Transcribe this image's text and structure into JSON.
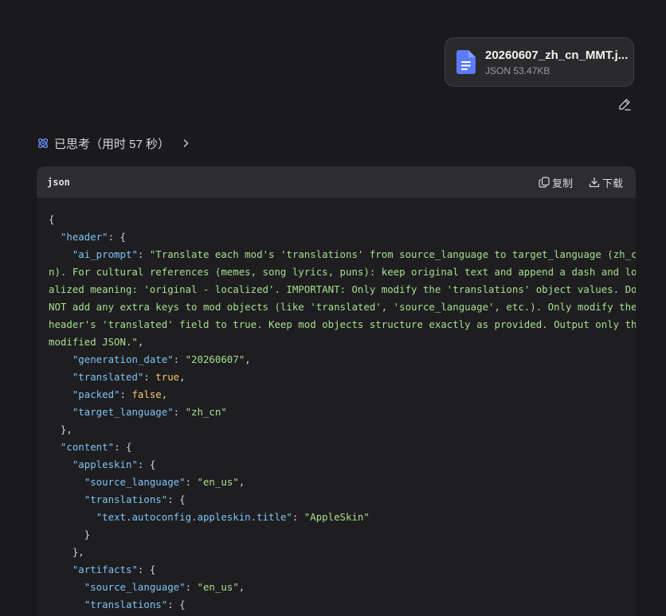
{
  "attachment": {
    "file_name": "20260607_zh_cn_MMT.j...",
    "file_info": "JSON 53.47KB",
    "icon": "document-icon",
    "icon_color": "#5b7cf6"
  },
  "thinking": {
    "label": "已思考（用时 57 秒）",
    "icon": "atom-icon",
    "icon_color": "#6c8cff"
  },
  "code_block": {
    "language": "json",
    "copy_label": "复制",
    "download_label": "下载",
    "lines": [
      [
        {
          "t": "p",
          "v": "{"
        }
      ],
      [
        {
          "t": "p",
          "v": "  "
        },
        {
          "t": "k",
          "v": "\"header\""
        },
        {
          "t": "p",
          "v": ": {"
        }
      ],
      [
        {
          "t": "p",
          "v": "    "
        },
        {
          "t": "k",
          "v": "\"ai_prompt\""
        },
        {
          "t": "p",
          "v": ": "
        },
        {
          "t": "s",
          "v": "\"Translate each mod's 'translations' from source_language to target_language (zh_c"
        }
      ],
      [
        {
          "t": "s",
          "v": "n). For cultural references (memes, song lyrics, puns): keep original text and append a dash and loc"
        }
      ],
      [
        {
          "t": "s",
          "v": "alized meaning: 'original - localized'. IMPORTANT: Only modify the 'translations' object values. Do"
        }
      ],
      [
        {
          "t": "s",
          "v": "NOT add any extra keys to mod objects (like 'translated', 'source_language', etc.). Only modify the"
        }
      ],
      [
        {
          "t": "s",
          "v": "header's 'translated' field to true. Keep mod objects structure exactly as provided. Output only the"
        }
      ],
      [
        {
          "t": "s",
          "v": "modified JSON.\""
        },
        {
          "t": "p",
          "v": ","
        }
      ],
      [
        {
          "t": "p",
          "v": "    "
        },
        {
          "t": "k",
          "v": "\"generation_date\""
        },
        {
          "t": "p",
          "v": ": "
        },
        {
          "t": "s",
          "v": "\"20260607\""
        },
        {
          "t": "p",
          "v": ","
        }
      ],
      [
        {
          "t": "p",
          "v": "    "
        },
        {
          "t": "k",
          "v": "\"translated\""
        },
        {
          "t": "p",
          "v": ": "
        },
        {
          "t": "b",
          "v": "true"
        },
        {
          "t": "p",
          "v": ","
        }
      ],
      [
        {
          "t": "p",
          "v": "    "
        },
        {
          "t": "k",
          "v": "\"packed\""
        },
        {
          "t": "p",
          "v": ": "
        },
        {
          "t": "b",
          "v": "false"
        },
        {
          "t": "p",
          "v": ","
        }
      ],
      [
        {
          "t": "p",
          "v": "    "
        },
        {
          "t": "k",
          "v": "\"target_language\""
        },
        {
          "t": "p",
          "v": ": "
        },
        {
          "t": "s",
          "v": "\"zh_cn\""
        }
      ],
      [
        {
          "t": "p",
          "v": "  },"
        }
      ],
      [
        {
          "t": "p",
          "v": "  "
        },
        {
          "t": "k",
          "v": "\"content\""
        },
        {
          "t": "p",
          "v": ": {"
        }
      ],
      [
        {
          "t": "p",
          "v": "    "
        },
        {
          "t": "k",
          "v": "\"appleskin\""
        },
        {
          "t": "p",
          "v": ": {"
        }
      ],
      [
        {
          "t": "p",
          "v": "      "
        },
        {
          "t": "k",
          "v": "\"source_language\""
        },
        {
          "t": "p",
          "v": ": "
        },
        {
          "t": "s",
          "v": "\"en_us\""
        },
        {
          "t": "p",
          "v": ","
        }
      ],
      [
        {
          "t": "p",
          "v": "      "
        },
        {
          "t": "k",
          "v": "\"translations\""
        },
        {
          "t": "p",
          "v": ": {"
        }
      ],
      [
        {
          "t": "p",
          "v": "        "
        },
        {
          "t": "k",
          "v": "\"text.autoconfig.appleskin.title\""
        },
        {
          "t": "p",
          "v": ": "
        },
        {
          "t": "s",
          "v": "\"AppleSkin\""
        }
      ],
      [
        {
          "t": "p",
          "v": "      }"
        }
      ],
      [
        {
          "t": "p",
          "v": "    },"
        }
      ],
      [
        {
          "t": "p",
          "v": "    "
        },
        {
          "t": "k",
          "v": "\"artifacts\""
        },
        {
          "t": "p",
          "v": ": {"
        }
      ],
      [
        {
          "t": "p",
          "v": "      "
        },
        {
          "t": "k",
          "v": "\"source_language\""
        },
        {
          "t": "p",
          "v": ": "
        },
        {
          "t": "s",
          "v": "\"en_us\""
        },
        {
          "t": "p",
          "v": ","
        }
      ],
      [
        {
          "t": "p",
          "v": "      "
        },
        {
          "t": "k",
          "v": "\"translations\""
        },
        {
          "t": "p",
          "v": ": {"
        }
      ]
    ]
  },
  "icons": {
    "edit": "pencil-icon",
    "expand": "chevron-right-icon",
    "copy": "copy-icon",
    "download": "download-icon"
  }
}
